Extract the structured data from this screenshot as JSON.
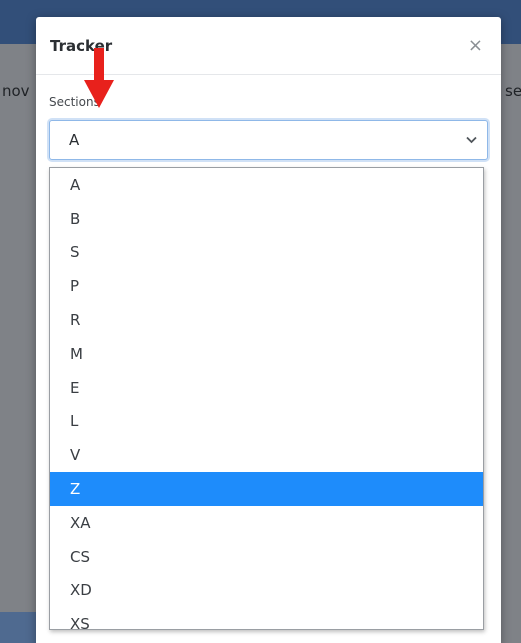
{
  "background": {
    "left_text": "nov",
    "right_text": "se"
  },
  "modal": {
    "title": "Tracker",
    "close_glyph": "×"
  },
  "sections": {
    "label": "Sections",
    "selected_value": "A",
    "options": [
      "A",
      "B",
      "S",
      "P",
      "R",
      "M",
      "E",
      "L",
      "V",
      "Z",
      "XA",
      "CS",
      "XD",
      "XS"
    ],
    "highlighted_option": "Z"
  },
  "icons": {
    "close": "close-icon",
    "chevron": "chevron-down-icon",
    "annotation_arrow": "red-arrow-down-icon"
  },
  "colors": {
    "header_bar": "#324f79",
    "highlight": "#1e8cfb",
    "annotation_arrow": "#e8211c",
    "select_focus_border": "#8fb8e8"
  }
}
